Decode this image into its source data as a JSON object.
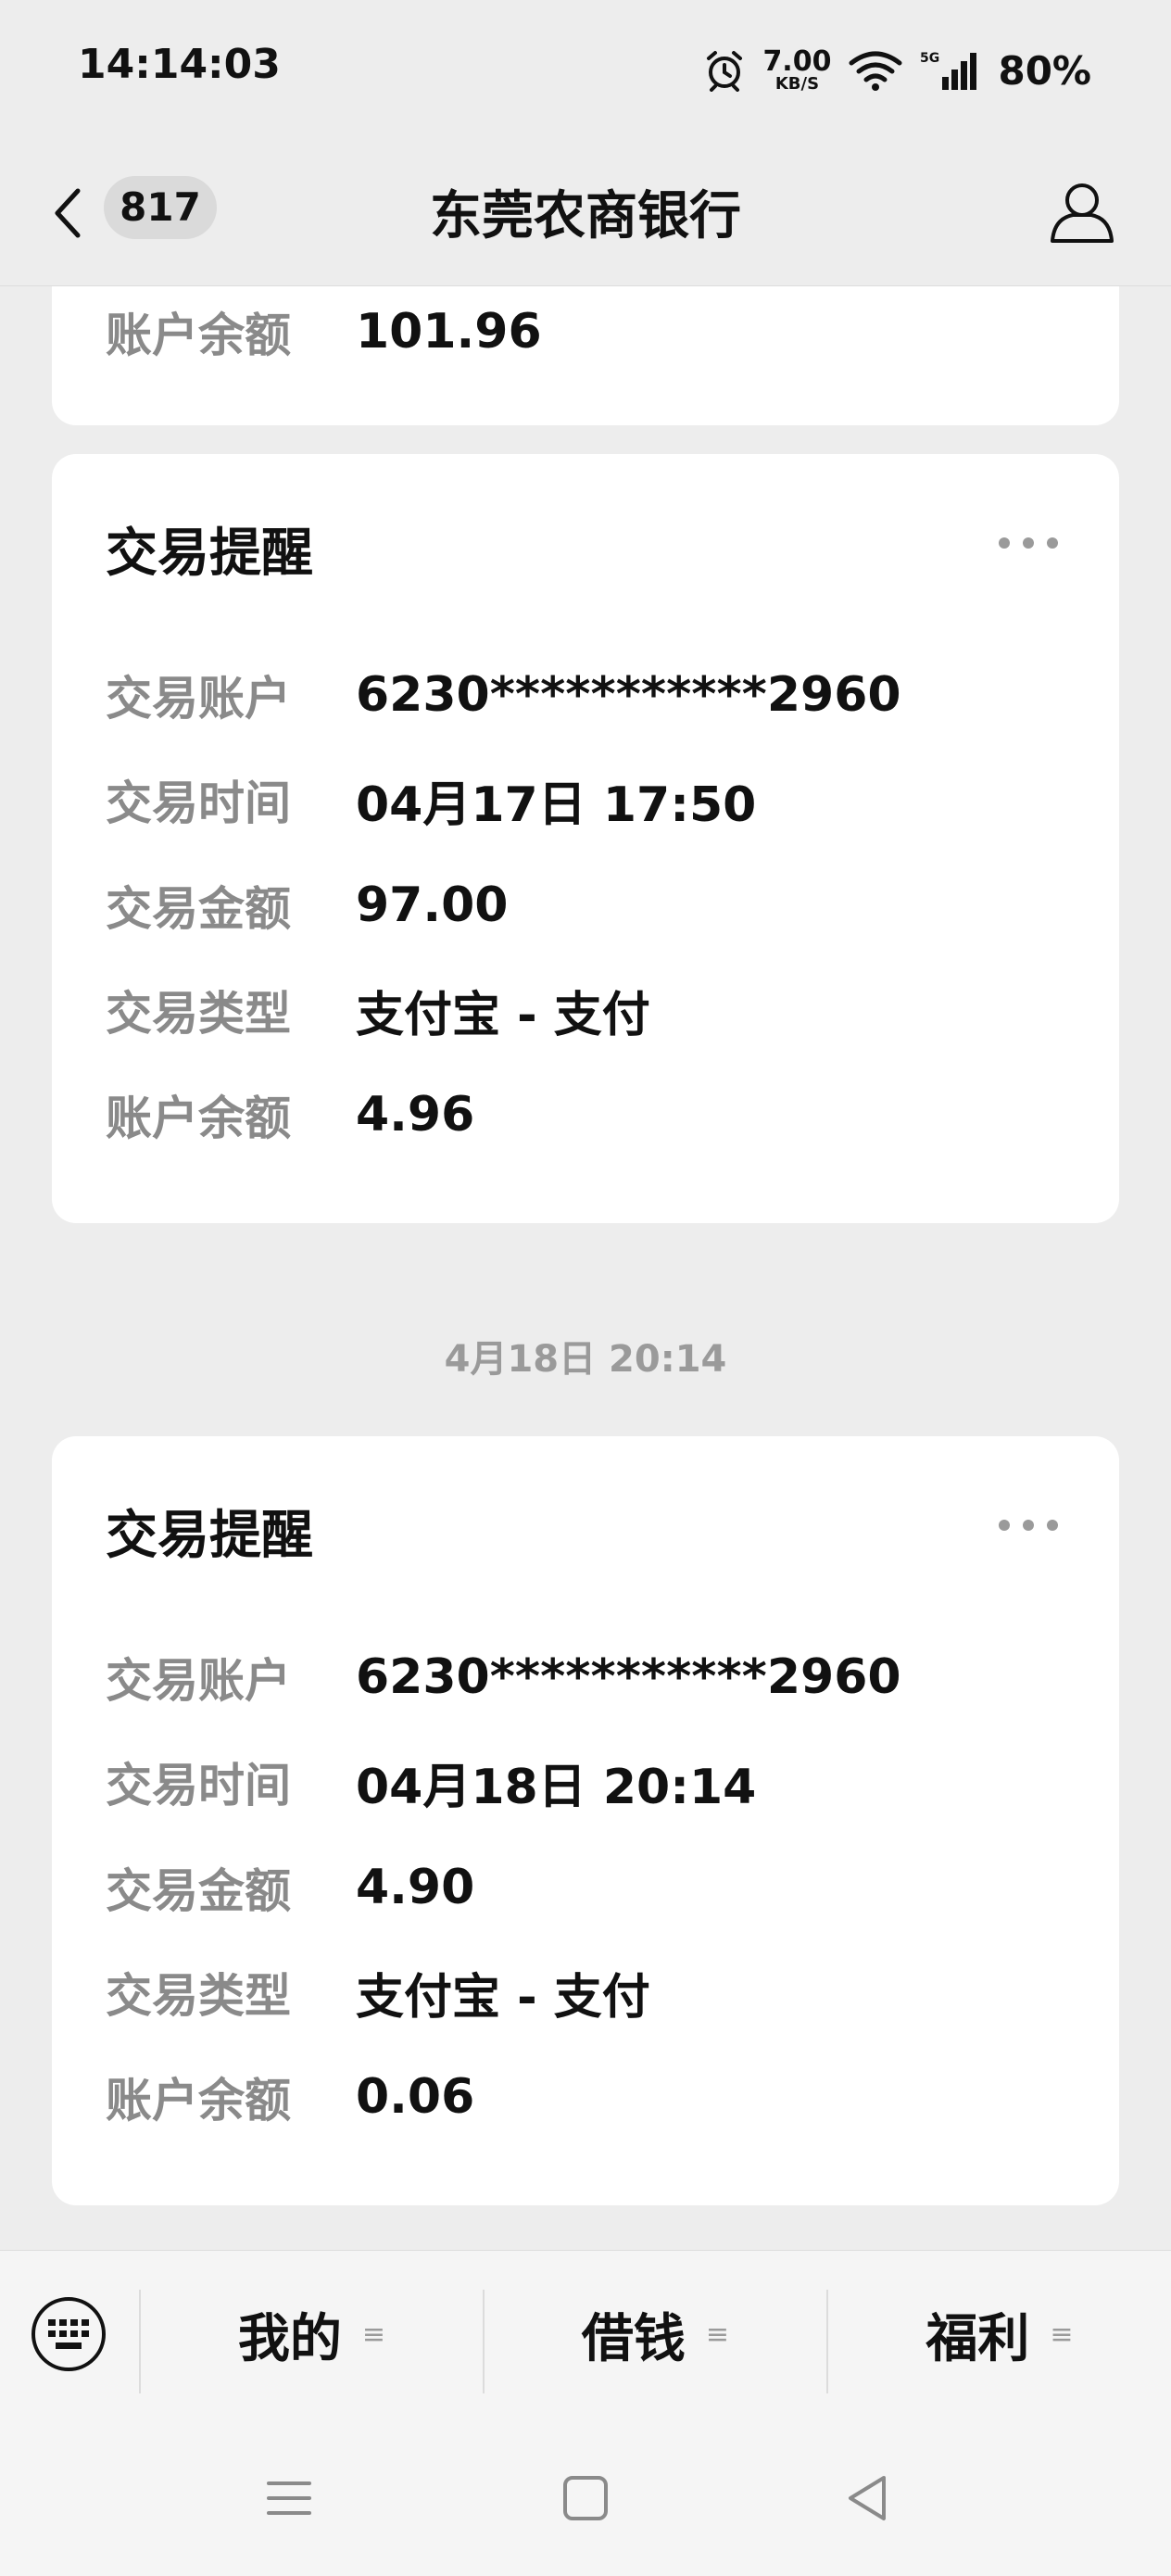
{
  "status_bar": {
    "time": "14:14:03",
    "net_speed_value": "7.00",
    "net_speed_unit": "KB/S",
    "network_type": "5G",
    "battery": "80%"
  },
  "nav": {
    "unread_count": "817",
    "title": "东莞农商银行"
  },
  "partial_card": {
    "rows": [
      {
        "label": "账户余额",
        "value": "101.96"
      }
    ]
  },
  "timestamp": "4月18日 20:14",
  "cards": [
    {
      "title": "交易提醒",
      "rows": [
        {
          "label": "交易账户",
          "value": "6230***********2960"
        },
        {
          "label": "交易时间",
          "value": "04月17日 17:50"
        },
        {
          "label": "交易金额",
          "value": "97.00"
        },
        {
          "label": "交易类型",
          "value": "支付宝 - 支付"
        },
        {
          "label": "账户余额",
          "value": "4.96"
        }
      ]
    },
    {
      "title": "交易提醒",
      "rows": [
        {
          "label": "交易账户",
          "value": "6230***********2960"
        },
        {
          "label": "交易时间",
          "value": "04月18日 20:14"
        },
        {
          "label": "交易金额",
          "value": "4.90"
        },
        {
          "label": "交易类型",
          "value": "支付宝 - 支付"
        },
        {
          "label": "账户余额",
          "value": "0.06"
        }
      ]
    }
  ],
  "bottom_menu": {
    "items": [
      {
        "label": "我的"
      },
      {
        "label": "借钱"
      },
      {
        "label": "福利"
      }
    ],
    "menu_glyph": "≡"
  }
}
